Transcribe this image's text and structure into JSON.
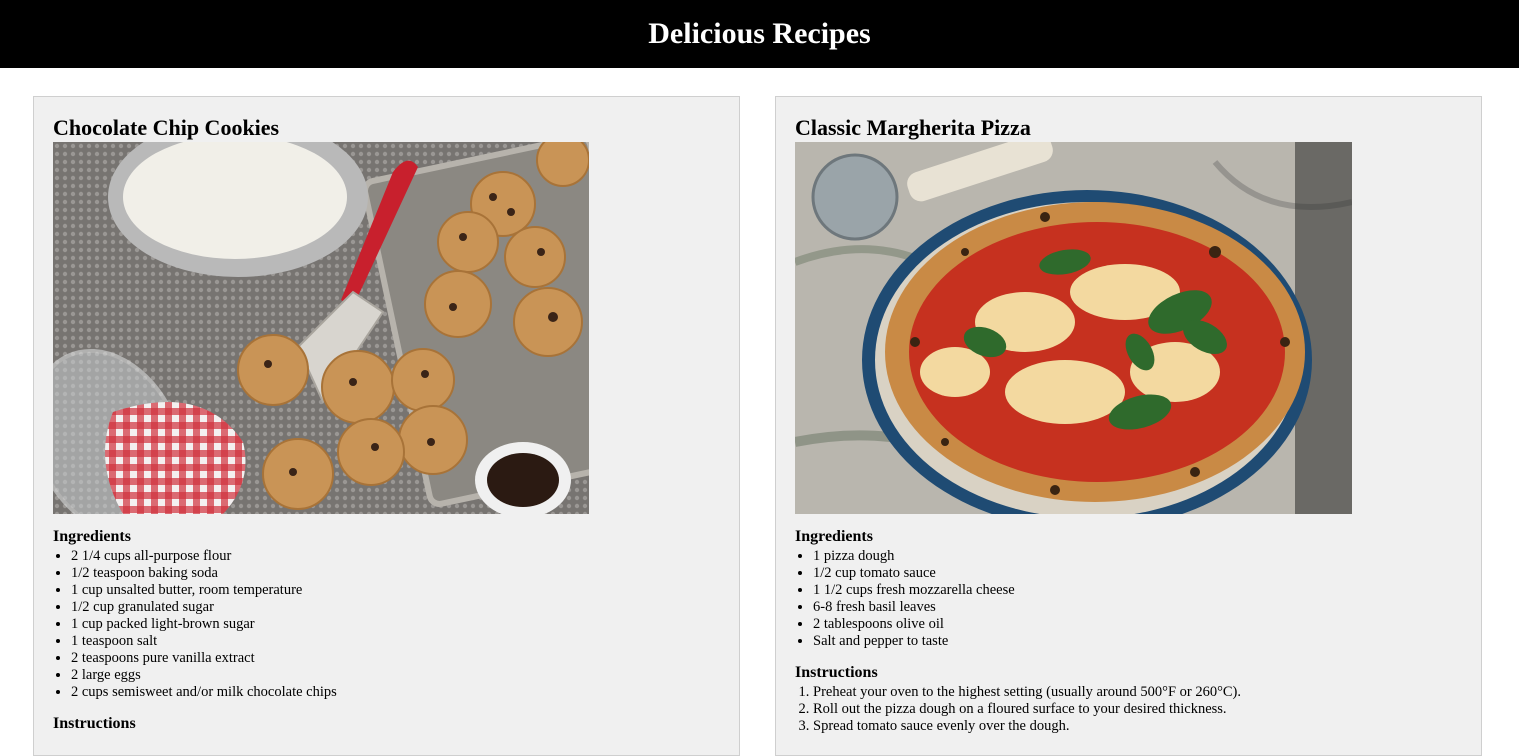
{
  "header": {
    "title": "Delicious Recipes"
  },
  "recipes": [
    {
      "title": "Chocolate Chip Cookies",
      "image_alt": "Chocolate chip cookies on a tray",
      "ingredients_heading": "Ingredients",
      "ingredients": [
        "2 1/4 cups all-purpose flour",
        "1/2 teaspoon baking soda",
        "1 cup unsalted butter, room temperature",
        "1/2 cup granulated sugar",
        "1 cup packed light-brown sugar",
        "1 teaspoon salt",
        "2 teaspoons pure vanilla extract",
        "2 large eggs",
        "2 cups semisweet and/or milk chocolate chips"
      ],
      "instructions_heading": "Instructions",
      "instructions": []
    },
    {
      "title": "Classic Margherita Pizza",
      "image_alt": "Margherita pizza with basil",
      "ingredients_heading": "Ingredients",
      "ingredients": [
        "1 pizza dough",
        "1/2 cup tomato sauce",
        "1 1/2 cups fresh mozzarella cheese",
        "6-8 fresh basil leaves",
        "2 tablespoons olive oil",
        "Salt and pepper to taste"
      ],
      "instructions_heading": "Instructions",
      "instructions": [
        "Preheat your oven to the highest setting (usually around 500°F or 260°C).",
        "Roll out the pizza dough on a floured surface to your desired thickness.",
        "Spread tomato sauce evenly over the dough."
      ]
    }
  ]
}
